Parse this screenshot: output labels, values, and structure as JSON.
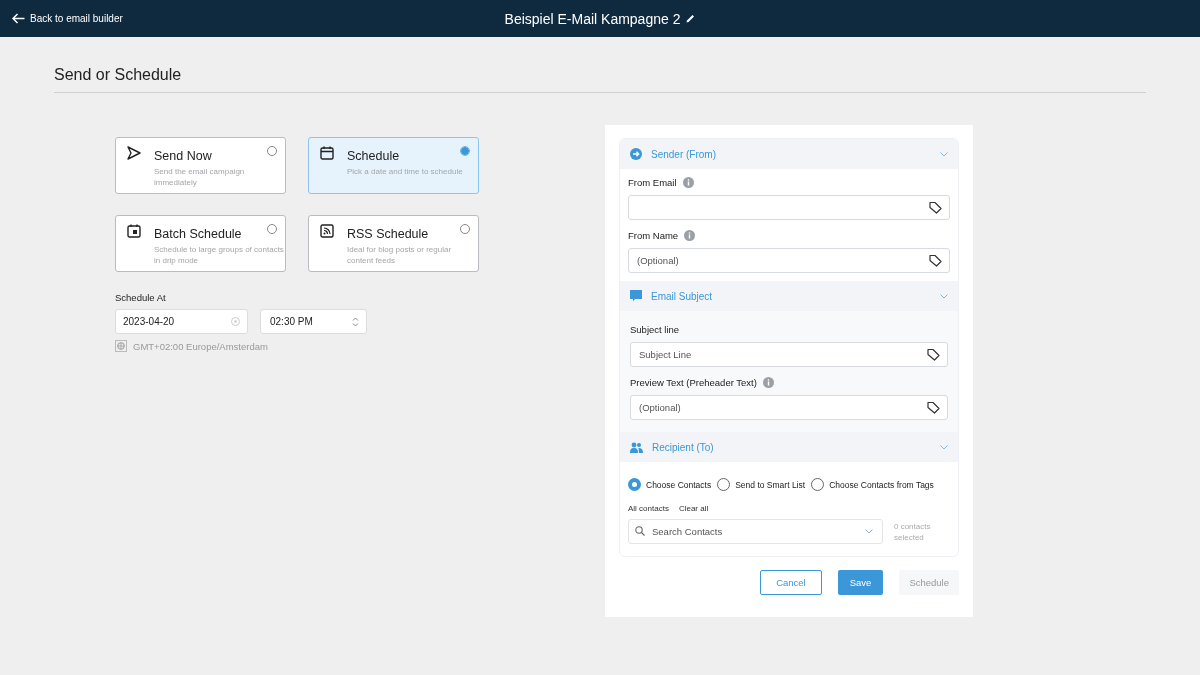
{
  "header": {
    "back_label": "Back to email builder",
    "title": "Beispiel E-Mail Kampagne 2"
  },
  "page_title": "Send or Schedule",
  "options": [
    {
      "kind": "send",
      "title": "Send Now",
      "description": "Send the email campaign immediately",
      "selected": false
    },
    {
      "kind": "schedule",
      "title": "Schedule",
      "description": "Pick a date and time to schedule",
      "selected": true
    },
    {
      "kind": "batch",
      "title": "Batch Schedule",
      "description": "Schedule to large groups of contacts in drip mode",
      "selected": false
    },
    {
      "kind": "rss",
      "title": "RSS Schedule",
      "description": "Ideal for blog posts or regular content feeds",
      "selected": false
    }
  ],
  "schedule_at": {
    "label": "Schedule At",
    "date": "2023-04-20",
    "time": "02:30 PM",
    "timezone": "GMT+02:00 Europe/Amsterdam"
  },
  "sections": [
    {
      "kind": "sender",
      "title": "Sender (From)",
      "fields": [
        {
          "label": "From Email",
          "info": true
        },
        {
          "label": "From Name",
          "info": true,
          "placeholder": "(Optional)"
        }
      ]
    },
    {
      "kind": "subject",
      "title": "Email Subject",
      "fields": [
        {
          "label": "Subject line",
          "info": false,
          "placeholder": "Subject Line"
        },
        {
          "label": "Preview Text (Preheader Text)",
          "info": true,
          "placeholder": "(Optional)"
        }
      ]
    },
    {
      "kind": "recipient",
      "title": "Recipient (To)",
      "recipient_modes": [
        {
          "label": "Choose Contacts",
          "selected": true
        },
        {
          "label": "Send to Smart List",
          "selected": false
        },
        {
          "label": "Choose Contacts from Tags",
          "selected": false
        }
      ],
      "links": [
        "All contacts",
        "Clear all"
      ],
      "search_placeholder": "Search Contacts",
      "count": "0 contacts selected"
    }
  ],
  "buttons": [
    {
      "kind": "outline",
      "label": "Cancel",
      "disabled": false
    },
    {
      "kind": "primary",
      "label": "Save",
      "disabled": false
    },
    {
      "kind": "plain",
      "label": "Schedule",
      "disabled": true
    }
  ]
}
